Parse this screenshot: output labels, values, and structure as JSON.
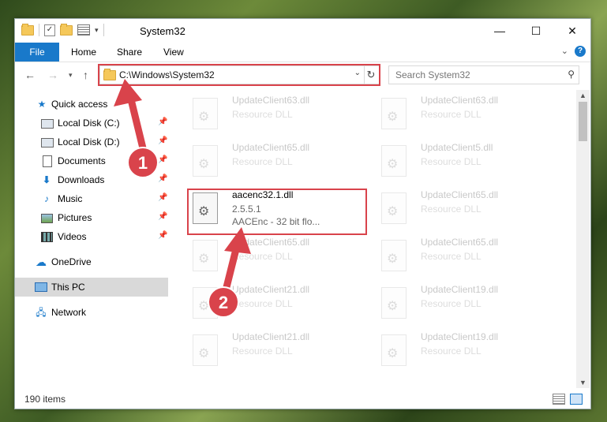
{
  "window": {
    "title": "System32"
  },
  "ribbon": {
    "tabs": [
      "File",
      "Home",
      "Share",
      "View"
    ]
  },
  "navbar": {
    "address": "C:\\Windows\\System32",
    "search_placeholder": "Search System32"
  },
  "navpane": {
    "items": [
      {
        "label": "Quick access",
        "icon": "star-icon"
      },
      {
        "label": "Local Disk (C:)",
        "icon": "drive-icon",
        "pinned": true
      },
      {
        "label": "Local Disk (D:)",
        "icon": "drive-icon",
        "pinned": true
      },
      {
        "label": "Documents",
        "icon": "document-icon",
        "pinned": true
      },
      {
        "label": "Downloads",
        "icon": "download-icon",
        "pinned": true
      },
      {
        "label": "Music",
        "icon": "music-icon",
        "pinned": true
      },
      {
        "label": "Pictures",
        "icon": "pictures-icon",
        "pinned": true
      },
      {
        "label": "Videos",
        "icon": "videos-icon",
        "pinned": true
      },
      {
        "label": "OneDrive",
        "icon": "cloud-icon"
      },
      {
        "label": "This PC",
        "icon": "computer-icon",
        "selected": true
      },
      {
        "label": "Network",
        "icon": "network-icon"
      }
    ]
  },
  "files": {
    "items": [
      {
        "name": "UpdateClient63.dll",
        "line2": "Resource DLL",
        "line3": ""
      },
      {
        "name": "UpdateClient63.dll",
        "line2": "Resource DLL",
        "line3": ""
      },
      {
        "name": "UpdateClient65.dll",
        "line2": "Resource DLL",
        "line3": ""
      },
      {
        "name": "UpdateClient5.dll",
        "line2": "Resource DLL",
        "line3": ""
      },
      {
        "name": "aacenc32.1.dll",
        "line2": "2.5.5.1",
        "line3": "AACEnc - 32 bit flo..."
      },
      {
        "name": "UpdateClient65.dll",
        "line2": "Resource DLL",
        "line3": ""
      },
      {
        "name": "UpdateClient65.dll",
        "line2": "Resource DLL",
        "line3": ""
      },
      {
        "name": "UpdateClient65.dll",
        "line2": "Resource DLL",
        "line3": ""
      },
      {
        "name": "UpdateClient21.dll",
        "line2": "Resource DLL",
        "line3": ""
      },
      {
        "name": "UpdateClient19.dll",
        "line2": "Resource DLL",
        "line3": ""
      },
      {
        "name": "UpdateClient21.dll",
        "line2": "Resource DLL",
        "line3": ""
      },
      {
        "name": "UpdateClient19.dll",
        "line2": "Resource DLL",
        "line3": ""
      }
    ]
  },
  "status": {
    "item_count": "190 items"
  },
  "annotations": {
    "step1": "1",
    "step2": "2",
    "color": "#d9434b"
  }
}
